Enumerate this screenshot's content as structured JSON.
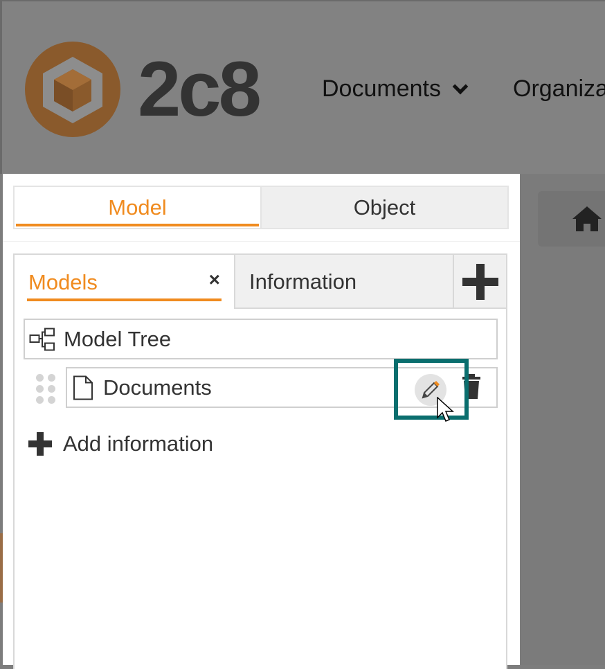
{
  "app": {
    "logo_text": "2c8",
    "nav": {
      "documents_label": "Documents",
      "organization_label": "Organiza"
    }
  },
  "panel": {
    "top_tabs": [
      {
        "label": "Model",
        "active": true
      },
      {
        "label": "Object",
        "active": false
      }
    ],
    "sub_tabs": {
      "models_label": "Models",
      "close_glyph": "×",
      "information_label": "Information",
      "add_icon": "plus-icon"
    },
    "tree": {
      "root_label": "Model Tree",
      "root_icon": "tree-icon",
      "items": [
        {
          "label": "Documents",
          "icon": "document-icon",
          "actions": [
            "pencil-icon",
            "trash-icon"
          ]
        }
      ]
    },
    "add_information_label": "Add information"
  },
  "colors": {
    "accent": "#f08b1f",
    "highlight": "#0a6e6e",
    "overlay": "#828282",
    "text": "#333333"
  }
}
